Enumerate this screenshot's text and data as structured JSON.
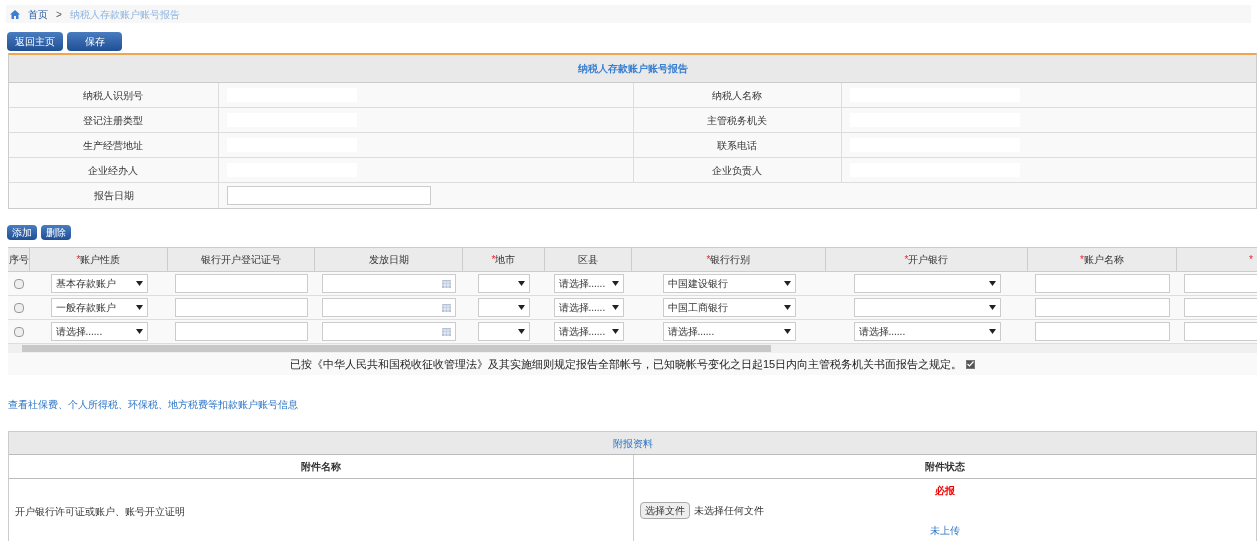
{
  "breadcrumb": [
    {
      "label": "首页",
      "current": false
    },
    {
      "label": ">",
      "kind": "separator"
    },
    {
      "label": "纳税人存款账户账号报告",
      "current": true
    }
  ],
  "top_buttons": [
    "返回主页",
    "保存"
  ],
  "info": {
    "title": "纳税人存款账户账号报告",
    "rows": [
      [
        {
          "label": "纳税人识别号"
        },
        {
          "label": "纳税人名称"
        }
      ],
      [
        {
          "label": "登记注册类型"
        },
        {
          "label": "主管税务机关"
        }
      ],
      [
        {
          "label": "生产经营地址"
        },
        {
          "label": "联系电话"
        }
      ],
      [
        {
          "label": "企业经办人"
        },
        {
          "label": "企业负责人"
        }
      ]
    ],
    "date_label": "报告日期"
  },
  "grid_buttons": [
    "添加",
    "删除"
  ],
  "grid": {
    "columns": [
      {
        "label": "序号"
      },
      {
        "marker": "*",
        "label": "账户性质"
      },
      {
        "label": "银行开户登记证号"
      },
      {
        "label": "发放日期"
      },
      {
        "marker": "*",
        "label": "地市"
      },
      {
        "label": "区县"
      },
      {
        "marker": "*",
        "label": "银行行别"
      },
      {
        "marker": "*",
        "label": "开户银行"
      },
      {
        "marker": "*",
        "label": "账户名称"
      },
      {
        "marker": "*"
      }
    ],
    "rows": [
      {
        "checked": false,
        "account_type": "基本存款账户",
        "district": "请选择......",
        "bank_type": "中国建设银行"
      },
      {
        "checked": false,
        "account_type": "一般存款账户",
        "district": "请选择......",
        "bank_type": "中国工商银行"
      },
      {
        "checked": false,
        "account_type": "请选择......",
        "district": "请选择......",
        "bank_type": "请选择......",
        "open_bank": "请选择......"
      }
    ]
  },
  "statement": {
    "text": "已按《中华人民共和国税收征收管理法》及其实施细则规定报告全部帐号，已知晓帐号变化之日起15日内向主管税务机关书面报告之规定。",
    "checked": true
  },
  "link": "查看社保费、个人所得税、环保税、地方税费等扣款账户账号信息",
  "attachments": {
    "title": "附报资料",
    "columns": [
      "附件名称",
      "附件状态"
    ],
    "rows": [
      {
        "name": "开户银行许可证或账户、账号开立证明",
        "required_label": "必报",
        "file_button": "选择文件",
        "file_status": "未选择任何文件",
        "upload_status": "未上传"
      }
    ]
  }
}
